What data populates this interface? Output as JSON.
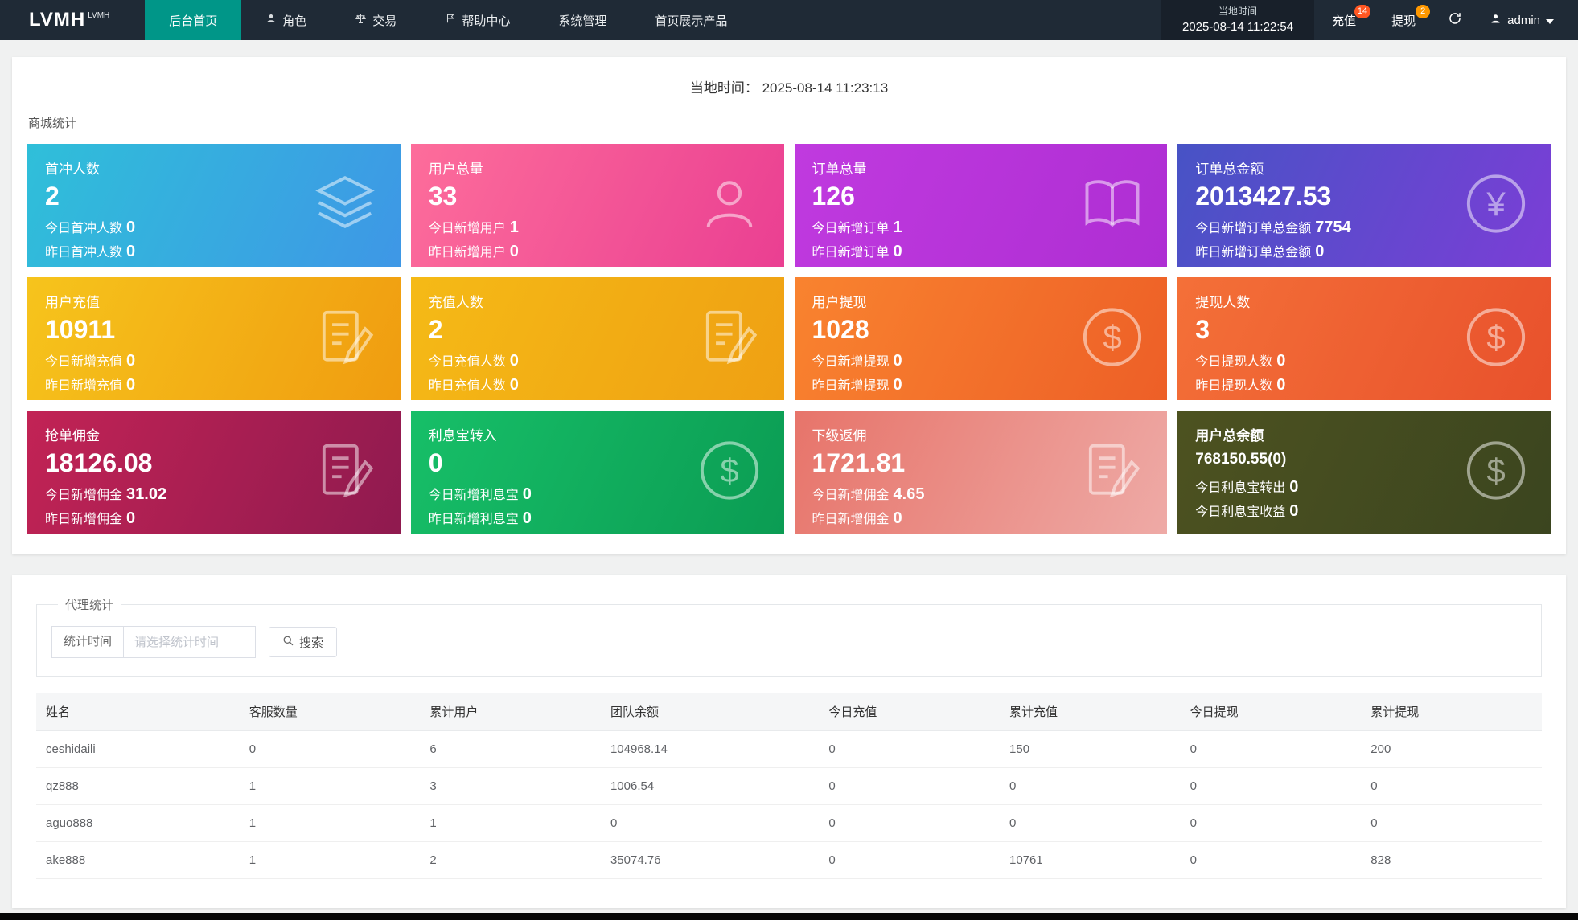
{
  "navbar": {
    "logo": "LVMH",
    "logo_sup": "LVMH",
    "active_color": "#009688",
    "items": [
      {
        "label": "后台首页",
        "icon": "none",
        "active": true
      },
      {
        "label": "角色",
        "icon": "user-icon",
        "active": false
      },
      {
        "label": "交易",
        "icon": "scales-icon",
        "active": false
      },
      {
        "label": "帮助中心",
        "icon": "flag-icon",
        "active": false
      },
      {
        "label": "系统管理",
        "icon": "none",
        "active": false
      },
      {
        "label": "首页展示产品",
        "icon": "none",
        "active": false
      }
    ],
    "local_time_label": "当地时间",
    "local_time_value": "2025-08-14 11:22:54",
    "recharge": {
      "label": "充值",
      "badge": "14",
      "badge_color": "#ff5722"
    },
    "withdraw": {
      "label": "提现",
      "badge": "2",
      "badge_color": "#ff9800"
    },
    "username": "admin"
  },
  "main": {
    "local_time_label": "当地时间：",
    "local_time_value": "2025-08-14 11:23:13",
    "section_title": "商城统计",
    "cards": [
      {
        "title": "首冲人数",
        "value": "2",
        "line1_label": "今日首冲人数",
        "line1_value": "0",
        "line2_label": "昨日首冲人数",
        "line2_value": "0",
        "icon": "layers-icon",
        "gradient": [
          "#2fbfd9",
          "#3e97e6"
        ]
      },
      {
        "title": "用户总量",
        "value": "33",
        "line1_label": "今日新增用户",
        "line1_value": "1",
        "line2_label": "昨日新增用户",
        "line2_value": "0",
        "icon": "user-icon",
        "gradient": [
          "#fd6d9b",
          "#ea3f92"
        ]
      },
      {
        "title": "订单总量",
        "value": "126",
        "line1_label": "今日新增订单",
        "line1_value": "1",
        "line2_label": "昨日新增订单",
        "line2_value": "0",
        "icon": "book-icon",
        "gradient": [
          "#c03adf",
          "#ae2ed3"
        ]
      },
      {
        "title": "订单总金额",
        "value": "2013427.53",
        "line1_label": "今日新增订单总金额",
        "line1_value": "7754",
        "line2_label": "昨日新增订单总金额",
        "line2_value": "0",
        "icon": "yen-circle-icon",
        "gradient": [
          "#4753c5",
          "#7b3ed6"
        ]
      },
      {
        "title": "用户充值",
        "value": "10911",
        "line1_label": "今日新增充值",
        "line1_value": "0",
        "line2_label": "昨日新增充值",
        "line2_value": "0",
        "icon": "edit-doc-icon",
        "gradient": [
          "#f6c41c",
          "#f09c10"
        ]
      },
      {
        "title": "充值人数",
        "value": "2",
        "line1_label": "今日充值人数",
        "line1_value": "0",
        "line2_label": "昨日充值人数",
        "line2_value": "0",
        "icon": "edit-doc-icon",
        "gradient": [
          "#f5ba16",
          "#efa013"
        ]
      },
      {
        "title": "用户提现",
        "value": "1028",
        "line1_label": "今日新增提现",
        "line1_value": "0",
        "line2_label": "昨日新增提现",
        "line2_value": "0",
        "icon": "dollar-circle-icon",
        "gradient": [
          "#f9832f",
          "#ed5f27"
        ]
      },
      {
        "title": "提现人数",
        "value": "3",
        "line1_label": "今日提现人数",
        "line1_value": "0",
        "line2_label": "昨日提现人数",
        "line2_value": "0",
        "icon": "dollar-circle-icon",
        "gradient": [
          "#f47038",
          "#e8512c"
        ]
      },
      {
        "title": "抢单佣金",
        "value": "18126.08",
        "line1_label": "今日新增佣金",
        "line1_value": "31.02",
        "line2_label": "昨日新增佣金",
        "line2_value": "0",
        "icon": "edit-doc-icon",
        "gradient": [
          "#c22355",
          "#8f1a4f"
        ]
      },
      {
        "title": "利息宝转入",
        "value": "0",
        "line1_label": "今日新增利息宝",
        "line1_value": "0",
        "line2_label": "昨日新增利息宝",
        "line2_value": "0",
        "icon": "dollar-circle-icon",
        "gradient": [
          "#17bf68",
          "#0b9c53"
        ]
      },
      {
        "title": "下级返佣",
        "value": "1721.81",
        "line1_label": "今日新增佣金",
        "line1_value": "4.65",
        "line2_label": "昨日新增佣金",
        "line2_value": "0",
        "icon": "edit-doc-icon",
        "gradient": [
          "#e7746a",
          "#eeaaa6"
        ]
      },
      {
        "title": "用户总余额",
        "value": "768150.55(0)",
        "line1_label": "今日利息宝转出",
        "line1_value": "0",
        "line2_label": "今日利息宝收益",
        "line2_value": "0",
        "icon": "dollar-circle-icon",
        "gradient": [
          "#4d5220",
          "#3b451f"
        ]
      }
    ]
  },
  "agent": {
    "legend": "代理统计",
    "filter_label": "统计时间",
    "placeholder": "请选择统计时间",
    "search_label": "搜索",
    "table": {
      "headers": [
        "姓名",
        "客服数量",
        "累计用户",
        "团队余额",
        "今日充值",
        "累计充值",
        "今日提现",
        "累计提现"
      ],
      "rows": [
        [
          "ceshidaili",
          "0",
          "6",
          "104968.14",
          "0",
          "150",
          "0",
          "200"
        ],
        [
          "qz888",
          "1",
          "3",
          "1006.54",
          "0",
          "0",
          "0",
          "0"
        ],
        [
          "aguo888",
          "1",
          "1",
          "0",
          "0",
          "0",
          "0",
          "0"
        ],
        [
          "ake888",
          "1",
          "2",
          "35074.76",
          "0",
          "10761",
          "0",
          "828"
        ]
      ]
    }
  }
}
